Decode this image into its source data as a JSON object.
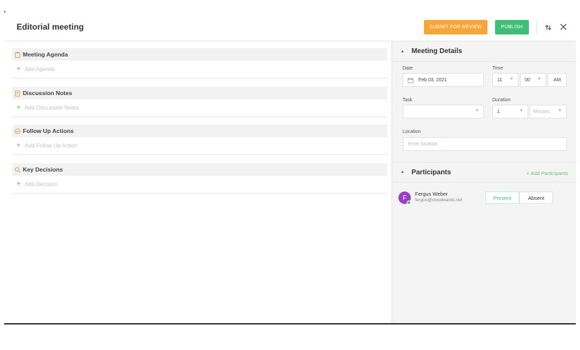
{
  "header": {
    "title": "Editorial meeting",
    "submit_label": "SUBMIT FOR REVIEW",
    "publish_label": "PUBLISH",
    "colors": {
      "submit": "#f7a536",
      "publish": "#3ebf75"
    }
  },
  "sections": [
    {
      "title": "Meeting Agenda",
      "add_label": "Add Agenda",
      "icon": "clipboard-icon"
    },
    {
      "title": "Discussion Notes",
      "add_label": "Add Discussion Notes",
      "icon": "notes-icon"
    },
    {
      "title": "Follow Up Actions",
      "add_label": "Add Follow Up Action",
      "icon": "check-circle-icon"
    },
    {
      "title": "Key Decisions",
      "add_label": "Add Decision",
      "icon": "search-icon"
    }
  ],
  "details": {
    "title": "Meeting Details",
    "date_label": "Date",
    "date_value": "Feb 03, 2021",
    "time_label": "Time",
    "hour": "11",
    "minute": "00",
    "ampm": "AM",
    "task_label": "Task",
    "task_value": "",
    "duration_label": "Duration",
    "duration_value": "1",
    "duration_unit": "Minutes",
    "location_label": "Location",
    "location_placeholder": "Enter location"
  },
  "participants": {
    "title": "Participants",
    "add_label": "+ Add Participants",
    "items": [
      {
        "initial": "F",
        "name": "Fergus Weber",
        "email": "fergus@cloudwards.net",
        "present_label": "Present",
        "absent_label": "Absent",
        "avatar_color": "#9b3fc9"
      }
    ]
  }
}
